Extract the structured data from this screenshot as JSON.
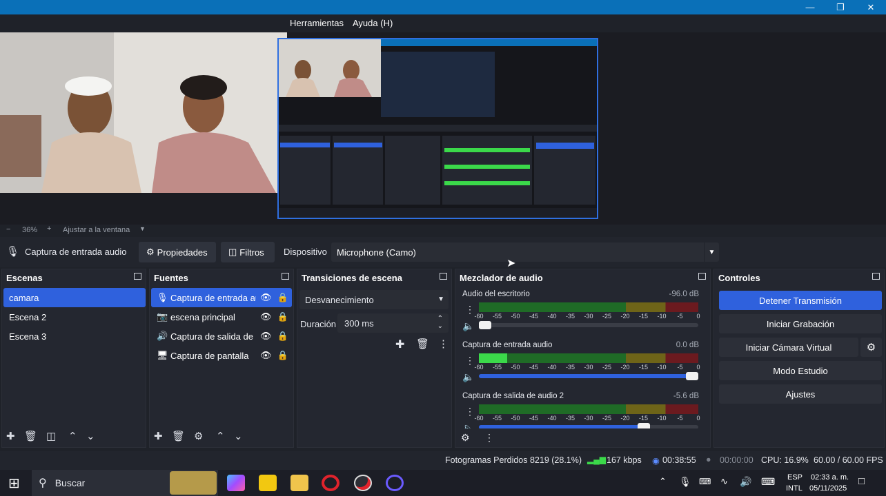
{
  "menu": {
    "tools": "Herramientas",
    "help": "Ayuda (H)"
  },
  "zoom": {
    "minus": "−",
    "level": "36%",
    "plus": "+",
    "fit": "Ajustar a la ventana"
  },
  "source_toolbar": {
    "source_name": "Captura de entrada audio",
    "properties": "Propiedades",
    "filters": "Filtros",
    "device_label": "Dispositivo",
    "device_value": "Microphone (Camo)"
  },
  "scenes": {
    "title": "Escenas",
    "items": [
      "camara",
      "Escena 2",
      "Escena 3"
    ]
  },
  "sources": {
    "title": "Fuentes",
    "items": [
      "Captura de entrada au",
      "escena principal",
      "Captura de salida de a",
      "Captura de pantalla"
    ]
  },
  "transitions": {
    "title": "Transiciones de escena",
    "type": "Desvanecimiento",
    "duration_label": "Duración",
    "duration_value": "300 ms"
  },
  "mixer": {
    "title": "Mezclador de audio",
    "scale": [
      "-60",
      "-55",
      "-50",
      "-45",
      "-40",
      "-35",
      "-30",
      "-25",
      "-20",
      "-15",
      "-10",
      "-5",
      "0"
    ],
    "channels": [
      {
        "name": "Audio del escritorio",
        "db": "-96.0 dB",
        "level": 0.0,
        "volume": 0.0
      },
      {
        "name": "Captura de entrada audio",
        "db": "0.0 dB",
        "level": 0.13,
        "volume": 1.0
      },
      {
        "name": "Captura de salida de audio 2",
        "db": "-5.6 dB",
        "level": 0.0,
        "volume": 0.75
      }
    ]
  },
  "controls": {
    "title": "Controles",
    "stop_stream": "Detener Transmisión",
    "start_record": "Iniciar Grabación",
    "start_virtual_cam": "Iniciar Cámara Virtual",
    "studio_mode": "Modo Estudio",
    "settings": "Ajustes"
  },
  "status": {
    "dropped_frames": "Fotogramas Perdidos 8219 (28.1%)",
    "bitrate": "167 kbps",
    "stream_time": "00:38:55",
    "record_time": "00:00:00",
    "cpu": "CPU: 16.9%",
    "fps": "60.00 / 60.00 FPS"
  },
  "taskbar": {
    "search": "Buscar",
    "lang1": "ESP",
    "lang2": "INTL",
    "time": "02:33 a. m.",
    "date": "05/11/2025"
  },
  "colors": {
    "accent": "#2f61dd",
    "titlebar": "#0a70b8",
    "meter_green": "#3bd94a",
    "meter_yellow": "#c8b52a",
    "meter_red": "#d0282f"
  }
}
